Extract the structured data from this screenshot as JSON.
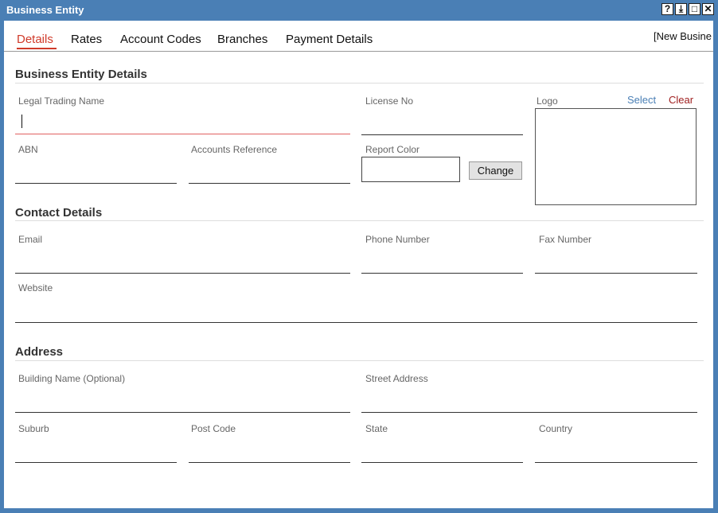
{
  "window": {
    "title": "Business Entity",
    "controls": {
      "help": "?",
      "download": "⤓",
      "maximize": "□",
      "close": "✕"
    }
  },
  "tabs": [
    "Details",
    "Rates",
    "Account Codes",
    "Branches",
    "Payment Details"
  ],
  "status_label": "[New Busine",
  "sections": {
    "business": "Business Entity Details",
    "contact": "Contact Details",
    "address": "Address"
  },
  "fields": {
    "legal_trading_name": "Legal Trading Name",
    "license_no": "License No",
    "logo": "Logo",
    "abn": "ABN",
    "accounts_reference": "Accounts Reference",
    "report_color": "Report Color",
    "email": "Email",
    "phone_number": "Phone Number",
    "fax_number": "Fax Number",
    "website": "Website",
    "building_name": "Building Name (Optional)",
    "street_address": "Street Address",
    "suburb": "Suburb",
    "post_code": "Post Code",
    "state": "State",
    "country": "Country"
  },
  "buttons": {
    "change": "Change",
    "select": "Select",
    "clear": "Clear"
  },
  "colors": {
    "accent": "#d03a2a",
    "titlebar": "#4a7fb5",
    "select_link": "#4a7fb5",
    "clear_link": "#a02020"
  }
}
